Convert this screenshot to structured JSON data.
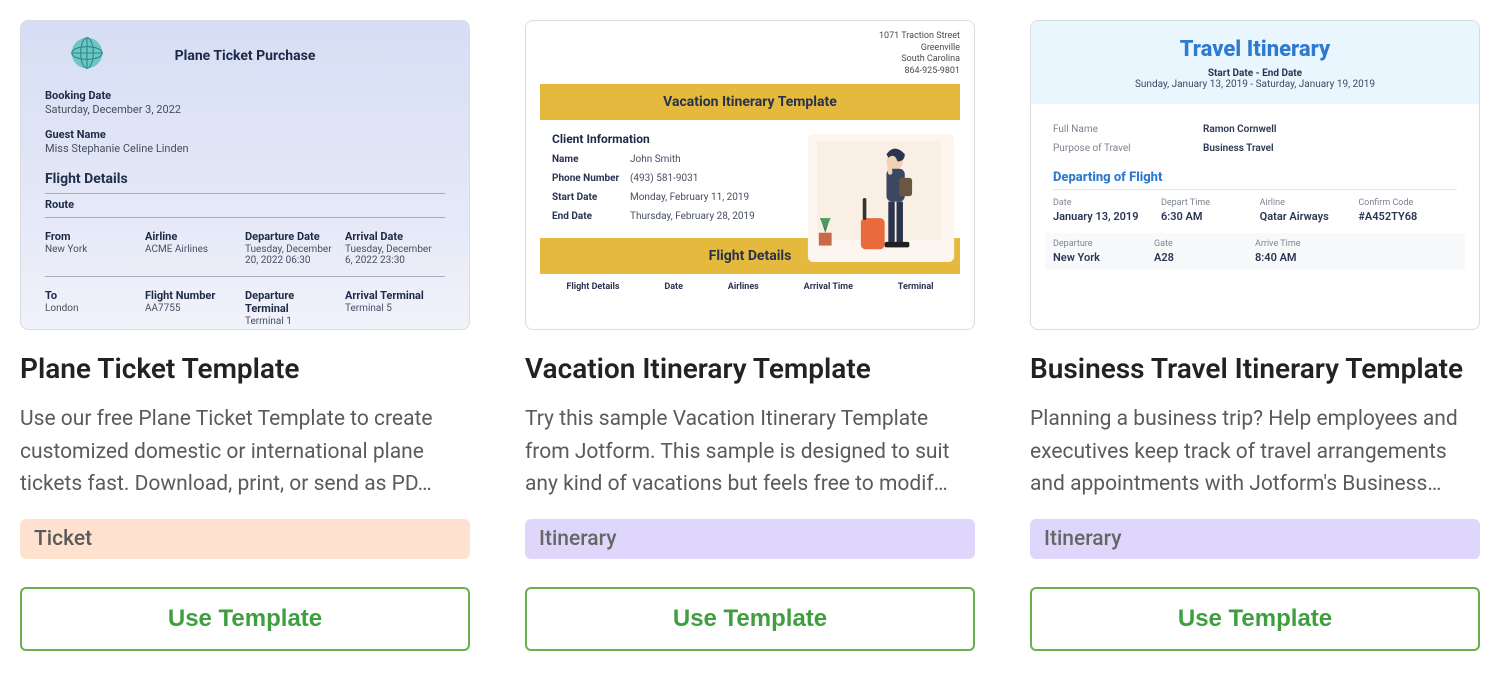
{
  "cards": [
    {
      "title": "Plane Ticket Template",
      "description": "Use our free Plane Ticket Template to create customized domestic or international plane tickets fast. Download, print, or send as PD…",
      "tag": {
        "label": "Ticket",
        "class": "tag-ticket"
      },
      "button_label": "Use Template",
      "preview": {
        "title": "Plane Ticket Purchase",
        "booking_date_label": "Booking Date",
        "booking_date": "Saturday, December 3, 2022",
        "guest_name_label": "Guest Name",
        "guest_name": "Miss Stephanie Celine Linden",
        "flight_details_label": "Flight Details",
        "route_label": "Route",
        "row1": {
          "c0": {
            "lbl": "From",
            "val": "New York"
          },
          "c1": {
            "lbl": "Airline",
            "val": "ACME Airlines"
          },
          "c2": {
            "lbl": "Departure Date",
            "val": "Tuesday, December 20, 2022 06:30"
          },
          "c3": {
            "lbl": "Arrival Date",
            "val": "Tuesday, December 6, 2022 23:30"
          }
        },
        "row2": {
          "c0": {
            "lbl": "To",
            "val": "London"
          },
          "c1": {
            "lbl": "Flight Number",
            "val": "AA7755"
          },
          "c2": {
            "lbl": "Departure Terminal",
            "val": "Terminal 1"
          },
          "c3": {
            "lbl": "Arrival Terminal",
            "val": "Terminal 5"
          }
        }
      }
    },
    {
      "title": "Vacation Itinerary Template",
      "description": "Try this sample Vacation Itinerary Template from Jotform. This sample is designed to suit any kind of vacations but feels free to modif…",
      "tag": {
        "label": "Itinerary",
        "class": "tag-itinerary"
      },
      "button_label": "Use Template",
      "preview": {
        "address": [
          "1071 Traction Street",
          "Greenville",
          "South Carolina",
          "864-925-9801"
        ],
        "banner1": "Vacation Itinerary Template",
        "section1": "Client Information",
        "name_label": "Name",
        "name": "John Smith",
        "phone_label": "Phone Number",
        "phone": "(493) 581-9031",
        "start_label": "Start Date",
        "start": "Monday, February 11, 2019",
        "end_label": "End Date",
        "end": "Thursday, February 28, 2019",
        "banner2": "Flight Details",
        "thead": [
          "Flight Details",
          "Date",
          "Airlines",
          "Arrival Time",
          "Terminal"
        ]
      }
    },
    {
      "title": "Business Travel Itinerary Template",
      "description": "Planning a business trip? Help employees and executives keep track of travel arrangements and appointments with Jotform's Business…",
      "tag": {
        "label": "Itinerary",
        "class": "tag-itinerary"
      },
      "button_label": "Use Template",
      "preview": {
        "title": "Travel Itinerary",
        "sub": "Start Date - End Date",
        "dates": "Sunday, January 13, 2019  -  Saturday, January 19, 2019",
        "fullname_label": "Full Name",
        "fullname": "Ramon Cornwell",
        "purpose_label": "Purpose of Travel",
        "purpose": "Business Travel",
        "section": "Departing of Flight",
        "grid1": {
          "c0": {
            "lbl": "Date",
            "val": "January 13, 2019"
          },
          "c1": {
            "lbl": "Depart Time",
            "val": "6:30 AM"
          },
          "c2": {
            "lbl": "Airline",
            "val": "Qatar Airways"
          },
          "c3": {
            "lbl": "Confirm Code",
            "val": "#A452TY68"
          }
        },
        "grid2": {
          "c0": {
            "lbl": "Departure",
            "val": "New York"
          },
          "c1": {
            "lbl": "Gate",
            "val": "A28"
          },
          "c2": {
            "lbl": "Arrive Time",
            "val": "8:40 AM"
          }
        }
      }
    }
  ]
}
